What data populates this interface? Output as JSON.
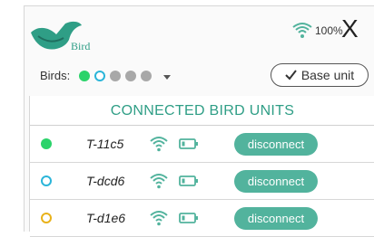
{
  "header": {
    "logo_text": "Bird",
    "wifi_percent": "100%",
    "close_label": "X"
  },
  "toolbar": {
    "birds_label": "Birds:",
    "bird_dots": [
      {
        "color": "#2bd36a",
        "style": "filled"
      },
      {
        "color": "#2bb5d9",
        "style": "outline"
      },
      {
        "color": "#a8a8a8",
        "style": "filled"
      },
      {
        "color": "#a8a8a8",
        "style": "filled"
      },
      {
        "color": "#a8a8a8",
        "style": "filled"
      }
    ],
    "base_unit_label": "Base unit"
  },
  "list": {
    "title": "CONNECTED BIRD UNITS",
    "rows": [
      {
        "id": "T-11c5",
        "dot_color": "#2bd36a",
        "dot_style": "filled",
        "action": "disconnect"
      },
      {
        "id": "T-dcd6",
        "dot_color": "#2bb5d9",
        "dot_style": "outline",
        "action": "disconnect"
      },
      {
        "id": "T-d1e6",
        "dot_color": "#e9b21a",
        "dot_style": "outline",
        "action": "disconnect"
      }
    ]
  },
  "colors": {
    "accent": "#2f9e86",
    "button": "#52b39d"
  }
}
